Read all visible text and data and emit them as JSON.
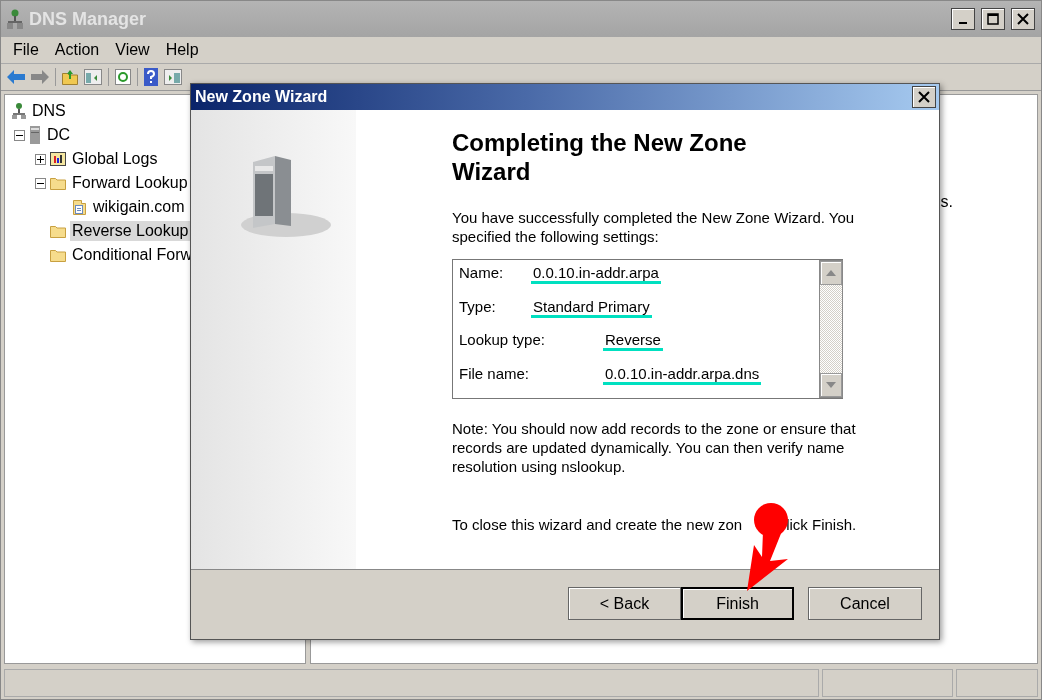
{
  "window": {
    "title": "DNS Manager"
  },
  "menu": [
    "File",
    "Action",
    "View",
    "Help"
  ],
  "tree": [
    {
      "label": "DNS",
      "kind": "root",
      "selected": false,
      "children": [
        {
          "label": "DC",
          "kind": "server",
          "expanded": true,
          "selected": false,
          "children": [
            {
              "label": "Global Logs",
              "kind": "log",
              "expanded": false,
              "selected": false
            },
            {
              "label": "Forward Lookup",
              "kind": "folder",
              "expanded": true,
              "selected": false,
              "children": [
                {
                  "label": "wikigain.com",
                  "kind": "zone",
                  "selected": false
                }
              ]
            },
            {
              "label": "Reverse Lookup",
              "kind": "folder",
              "selected": true
            },
            {
              "label": "Conditional Forw",
              "kind": "folder",
              "selected": false
            }
          ]
        }
      ]
    }
  ],
  "right_pane": {
    "text": "s."
  },
  "dialog": {
    "title": "New Zone Wizard",
    "heading": "Completing the New Zone Wizard",
    "intro": "You have successfully completed the New Zone Wizard. You specified the following settings:",
    "settings": [
      {
        "label": "Name:",
        "value": "0.0.10.in-addr.arpa",
        "highlighted": true
      },
      {
        "label": "Type:",
        "value": "Standard Primary",
        "highlighted": true
      },
      {
        "label": "Lookup type:",
        "value": "Reverse",
        "highlighted": true
      },
      {
        "label": "File name:",
        "value": "0.0.10.in-addr.arpa.dns",
        "highlighted": true
      }
    ],
    "note": "Note: You should now add records to the zone or ensure that records are updated dynamically. You can then verify name resolution using nslookup.",
    "closing_before": "To close this wizard and create the new zon",
    "closing_after": "lick Finish.",
    "buttons": [
      {
        "label": "< Back",
        "default": false
      },
      {
        "label": "Finish",
        "default": true
      },
      {
        "label": "Cancel",
        "default": false
      }
    ]
  }
}
